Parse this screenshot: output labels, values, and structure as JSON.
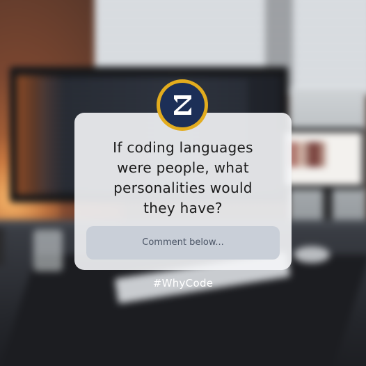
{
  "post": {
    "question_lines": [
      "If coding languages",
      "were people, what",
      "personalities would",
      "they have?"
    ],
    "comment_prompt": "Comment below...",
    "hashtag": "#WhyCode"
  },
  "logo": {
    "icon": "z-letter-logo-icon",
    "ring_color": "#e2ac1e",
    "fill_color": "#1c2f57"
  },
  "colors": {
    "card": "#f4f5f7",
    "comment_box": "#c9cfd8",
    "text": "#1a1a1a"
  }
}
